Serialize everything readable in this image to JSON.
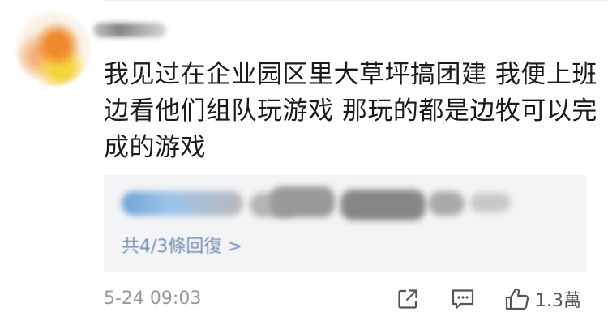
{
  "comment": {
    "text": "我见过在企业园区里大草坪搞团建 我便上班边看他们组队玩游戏 那玩的都是边牧可以完成的游戏",
    "timestamp": "5-24 09:03",
    "like_count": "1.3萬"
  },
  "replies": {
    "view_all_label": "共4/3條回復 >"
  },
  "icons": {
    "share": "share-icon",
    "comment": "comment-icon",
    "like": "thumbs-up-icon"
  },
  "colors": {
    "text": "#1a1a1a",
    "muted": "#9a9a9a",
    "reply_link": "#5b7ea8",
    "reply_bg": "#f3f4f6"
  }
}
